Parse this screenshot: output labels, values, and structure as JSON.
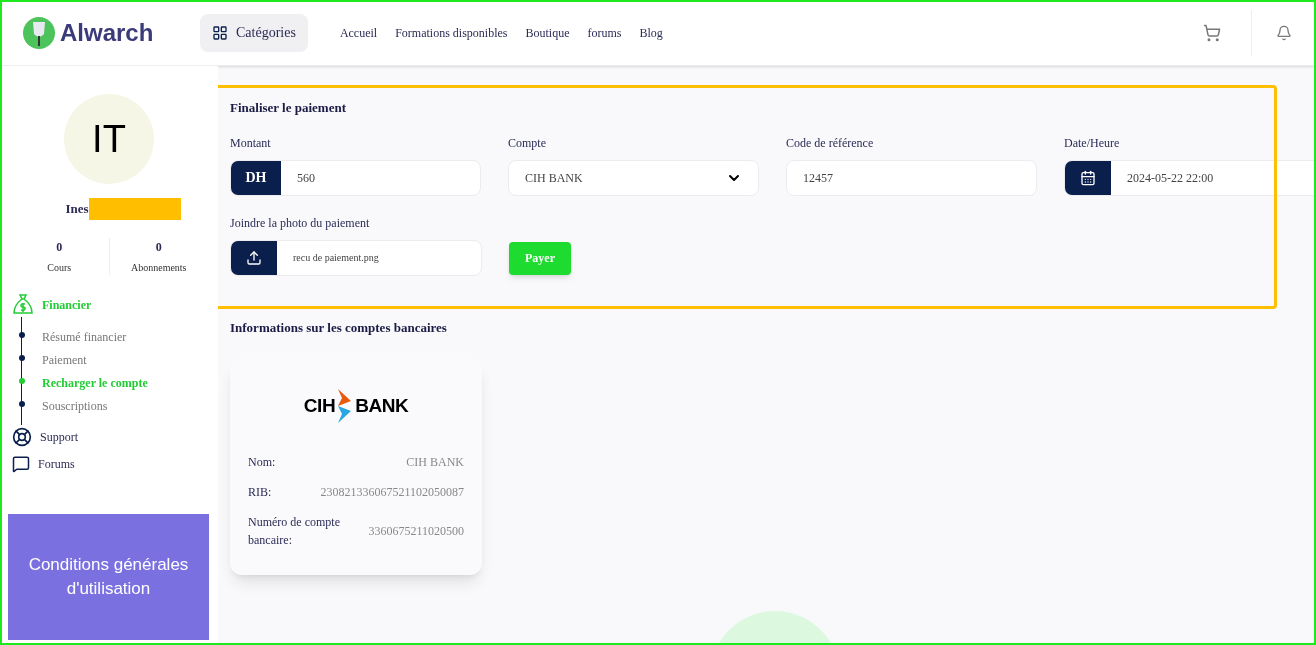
{
  "header": {
    "logo": "Alwarch",
    "categories_button": "Catégories",
    "nav": [
      "Accueil",
      "Formations disponibles",
      "Boutique",
      "forums",
      "Blog"
    ]
  },
  "profile": {
    "initials": "IT",
    "name": "Ines",
    "redacted": true,
    "stats": [
      {
        "value": "0",
        "label": "Cours"
      },
      {
        "value": "0",
        "label": "Abonnements"
      }
    ]
  },
  "menu": {
    "section": "Financier",
    "items": [
      {
        "label": "Résumé financier",
        "selected": false
      },
      {
        "label": "Paiement",
        "selected": false
      },
      {
        "label": "Recharger le compte",
        "selected": true
      },
      {
        "label": "Souscriptions",
        "selected": false
      }
    ],
    "other": [
      {
        "label": "Support",
        "kind": "support"
      },
      {
        "label": "Forums",
        "kind": "forums"
      }
    ]
  },
  "banner": {
    "text": "Conditions générales d'utilisation"
  },
  "payment": {
    "title": "Finaliser le paiement",
    "highlighted": true,
    "fields": [
      {
        "label": "Montant",
        "kind": "amount",
        "prefix": "DH",
        "value": "560"
      },
      {
        "label": "Compte",
        "kind": "select",
        "value": "CIH BANK"
      },
      {
        "label": "Code de référence",
        "kind": "text",
        "value": "12457"
      },
      {
        "label": "Date/Heure",
        "kind": "date",
        "value": "2024-05-22 22:00"
      }
    ],
    "attachment": {
      "label": "Joindre la photo du paiement",
      "file": "recu de paiement.png"
    },
    "submit": "Payer"
  },
  "bank_info": {
    "title": "Informations sur les comptes bancaires",
    "cards": [
      {
        "logo_left": "CIH",
        "logo_right": "BANK",
        "rows": [
          {
            "label": "Nom:",
            "value": "CIH BANK"
          },
          {
            "label": "RIB:",
            "value": "230821336067521102050087"
          },
          {
            "label": "Numéro de compte bancaire:",
            "value": "3360675211020500"
          }
        ]
      }
    ]
  }
}
